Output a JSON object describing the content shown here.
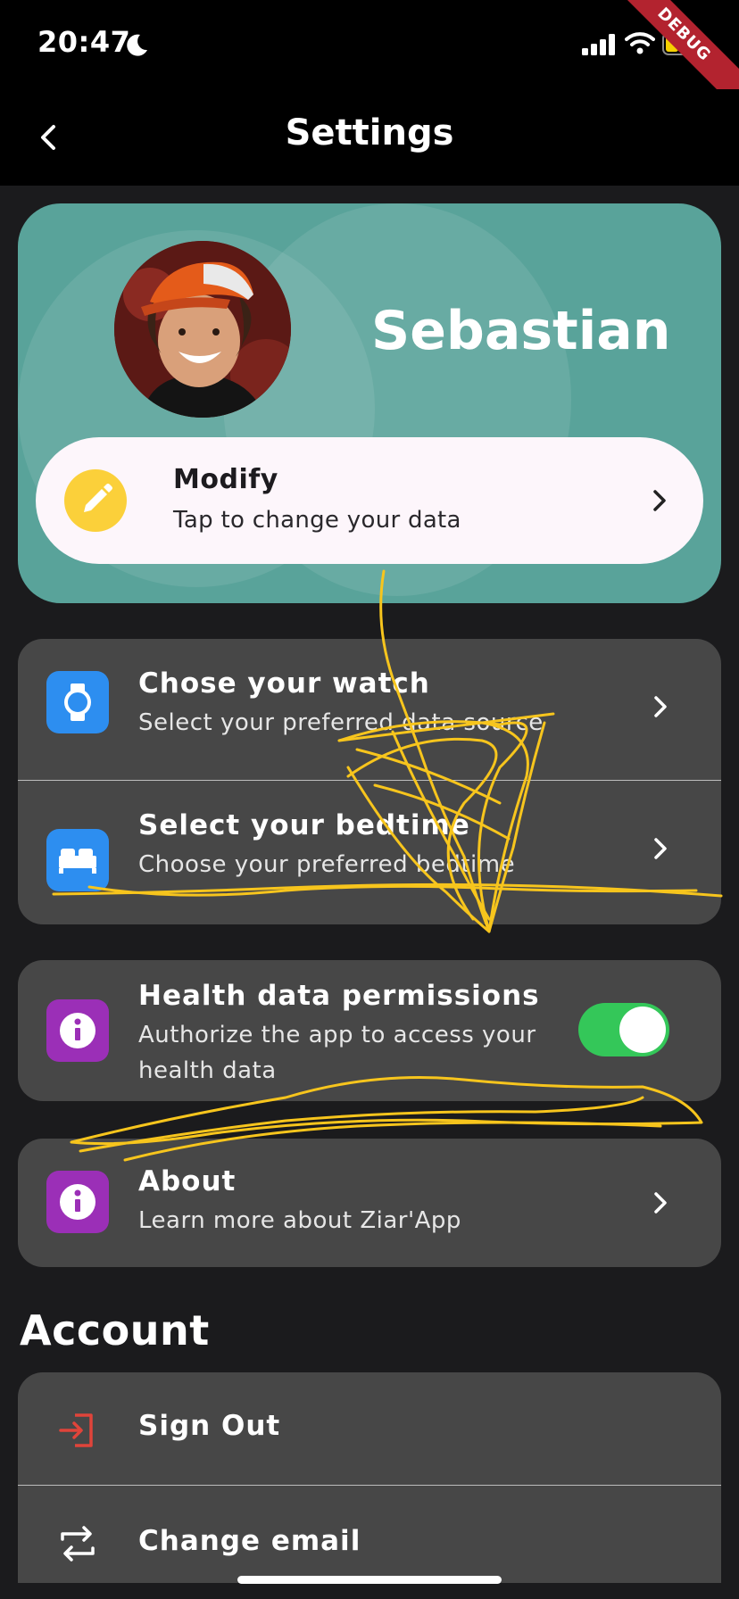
{
  "status_bar": {
    "time": "20:47"
  },
  "debug_banner": "DEBUG",
  "app_bar": {
    "title": "Settings"
  },
  "profile": {
    "name": "Sebastian",
    "modify": {
      "title": "Modify",
      "subtitle": "Tap to change your data"
    }
  },
  "settings": [
    {
      "title": "Chose your watch",
      "subtitle": "Select your preferred data source",
      "icon": "watch-icon",
      "color": "#2d8ef0"
    },
    {
      "title": "Select your bedtime",
      "subtitle": "Choose your preferred bedtime",
      "icon": "bed-icon",
      "color": "#2d8ef0"
    },
    {
      "title": "Health data permissions",
      "subtitle": "Authorize the app to access your health data",
      "icon": "info-icon",
      "color": "#9b2fb7",
      "toggle": true
    },
    {
      "title": "About",
      "subtitle": "Learn more about Ziar'App",
      "icon": "info-icon",
      "color": "#9b2fb7"
    }
  ],
  "account": {
    "section_title": "Account",
    "items": [
      {
        "label": "Sign Out",
        "icon": "sign-out-icon",
        "color": "#e0443a"
      },
      {
        "label": "Change email",
        "icon": "swap-icon",
        "color": "#ffffff"
      }
    ]
  },
  "colors": {
    "accent_card": "#59a39a",
    "toggle_on": "#34c759",
    "annotation": "#f7c51d"
  }
}
